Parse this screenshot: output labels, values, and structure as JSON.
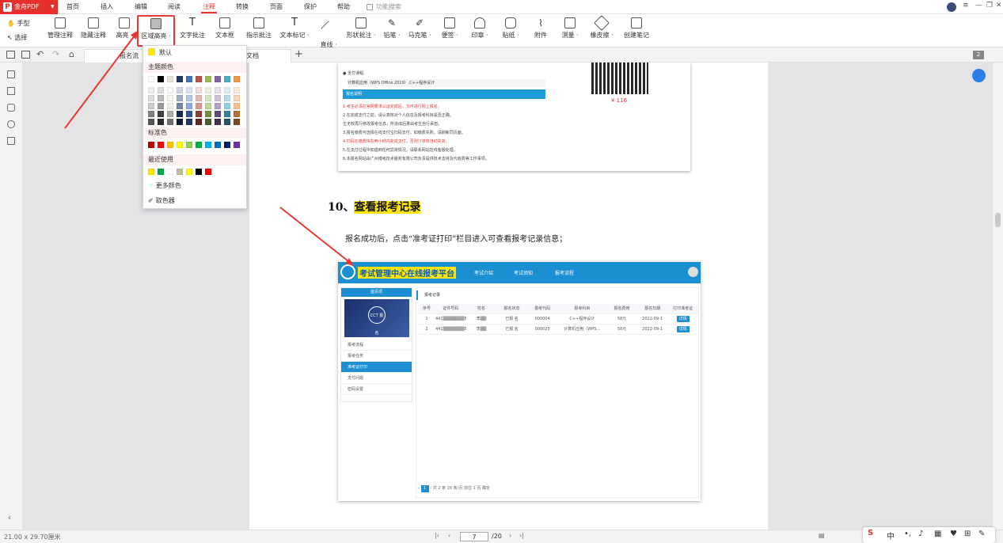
{
  "menubar": {
    "brand": "金舟PDF",
    "tabs": [
      "首页",
      "插入",
      "编辑",
      "阅读",
      "注释",
      "转换",
      "页面",
      "保护",
      "帮助"
    ],
    "active_tab": "注释",
    "search_placeholder": "功能搜索"
  },
  "toolbar": {
    "hand": "手型",
    "select": "选择",
    "items": [
      "管理注释",
      "隐藏注释",
      "高亮 ·",
      "区域高亮 ·",
      "文字批注",
      "文本框",
      "指示批注",
      "文本标记 ·",
      "直线 ·",
      "形状批注 ·",
      "铅笔 ·",
      "马克笔 ·",
      "便签 ·",
      "印章 ·",
      "贴纸 ·",
      "附件",
      "测量 ·",
      "橡皮擦 ·",
      "创建笔记"
    ],
    "selected": "区域高亮 ·"
  },
  "tabbar": {
    "doc_tab_1": "报名流",
    "doc_tab_2": "文档",
    "page_badge": "2"
  },
  "dropdown": {
    "default": "默认",
    "theme": "主题颜色",
    "standard": "标准色",
    "recent": "最近使用",
    "more": "更多颜色",
    "picker": "取色器",
    "theme_top": [
      "#ffffff",
      "#000000",
      "#e8e4d8",
      "#1f3864",
      "#4472c4",
      "#c0504d",
      "#9bbb59",
      "#8064a2",
      "#4bacc6",
      "#f79646"
    ],
    "standard_colors": [
      "#c00000",
      "#ff0000",
      "#ffc000",
      "#ffff00",
      "#92d050",
      "#00b050",
      "#00b0f0",
      "#0070c0",
      "#002060",
      "#7030a0"
    ],
    "recent_colors": [
      "#ffe600",
      "#00a650",
      "#ffffff",
      "#c0c0a0",
      "#ffff00",
      "#000000",
      "#ff0000"
    ],
    "default_color": "#ffe600"
  },
  "document": {
    "img1_row1": "● 支付课程:",
    "img1_row2": "计算机应用（WPS Office 2019）,C++程序设计",
    "img1_bar": "报名说明",
    "img1_notes": [
      "1.考生必须在官网要求认证完成后，方可进行网上报名。",
      "2.在完成支付之前，请认真核对个人信息及报考科目是否正确。",
      "生无权再行修改报考信息，所造成后果由考生自行承担。",
      "3.报名缴费可选择在线支付宝扫码支付，如缴费失败，请刷新同页面。",
      "4.扫码在缴费快在两小时内完成支付，否则订单将自动失效。",
      "5.在支付过程中如遇到任何异常情况，请联系网站在线客服处理。",
      "6.本报名网站由广州博考技术服务有限公司负责提供技术支持及代收费等工作事项。"
    ],
    "price": "¥ 116",
    "heading_num": "10、",
    "heading_text": "查看报考记录",
    "paragraph": "报名成功后，点击“准考证打印”栏目进入可查看报考记录信息；",
    "site_title": "考试管理中心在线报考平台",
    "site_nav": [
      "考试介绍",
      "考试须知",
      "报考流程"
    ],
    "side_header": "首页项",
    "side_badge": "CCT 报名",
    "side_menu": [
      "报考流程",
      "报考任务",
      "准考证打印",
      "支付问题",
      "密码设置"
    ],
    "side_active": "准考证打印",
    "main_header": "报考记录",
    "table_headers": [
      "序号",
      "证件号码",
      "姓名",
      "报名状态",
      "报考代码",
      "报考科目",
      "报名费用",
      "报名日期",
      "打印准考证"
    ],
    "table_rows": [
      [
        "1",
        "441▒▒▒▒▒▒▒511",
        "李▒▒",
        "已报 名",
        "000004",
        "C++程序设计",
        "58元",
        "2022-09-1",
        "详情"
      ],
      [
        "2",
        "441▒▒▒▒▒▒▒511",
        "李▒▒",
        "已报 名",
        "000025",
        "计算机应用（WPS…",
        "58元",
        "2022-09-1",
        "详情"
      ]
    ],
    "pager": "共 2 条   20 条/页   前往   1   页   确定",
    "pager_page": "1"
  },
  "status": {
    "size": "21.00 x 29.70厘米",
    "page": "7",
    "total": "/20"
  },
  "ime": {
    "cn": "中"
  }
}
